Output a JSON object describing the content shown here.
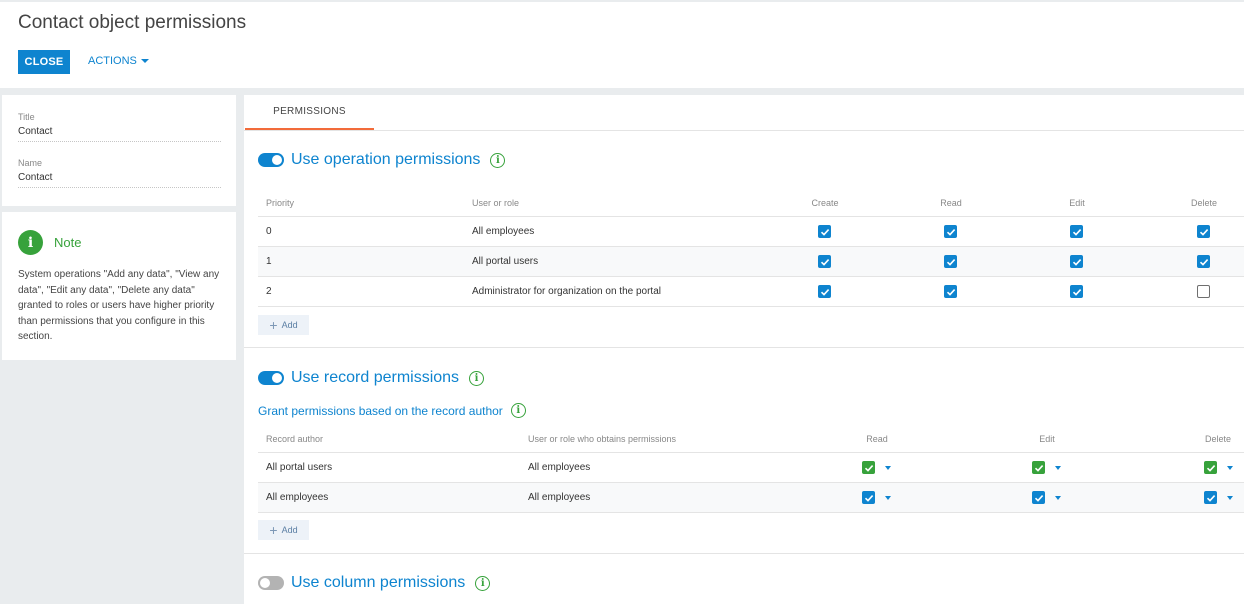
{
  "header": {
    "title": "Contact object permissions",
    "close_label": "CLOSE",
    "actions_label": "ACTIONS"
  },
  "details": {
    "title_label": "Title",
    "title_value": "Contact",
    "name_label": "Name",
    "name_value": "Contact"
  },
  "note": {
    "title": "Note",
    "text": "System operations \"Add any data\", \"View any data\", \"Edit any data\", \"Delete any data\" granted to roles or users have higher priority than permissions that you configure in this section."
  },
  "tabs": [
    {
      "label": "PERMISSIONS",
      "active": true
    }
  ],
  "operation_permissions": {
    "title": "Use operation permissions",
    "enabled": true,
    "columns": [
      "Priority",
      "User or role",
      "Create",
      "Read",
      "Edit",
      "Delete"
    ],
    "rows": [
      {
        "priority": "0",
        "role": "All employees",
        "create": true,
        "read": true,
        "edit": true,
        "delete": true
      },
      {
        "priority": "1",
        "role": "All portal users",
        "create": true,
        "read": true,
        "edit": true,
        "delete": true
      },
      {
        "priority": "2",
        "role": "Administrator for organization on the portal",
        "create": true,
        "read": true,
        "edit": true,
        "delete": false
      }
    ],
    "add_label": "Add"
  },
  "record_permissions": {
    "title": "Use record permissions",
    "enabled": true,
    "subtitle": "Grant permissions based on the record author",
    "columns": [
      "Record author",
      "User or role who obtains permissions",
      "Read",
      "Edit",
      "Delete"
    ],
    "rows": [
      {
        "author": "All portal users",
        "grantee": "All employees",
        "read": "green",
        "edit": "green",
        "delete": "green"
      },
      {
        "author": "All employees",
        "grantee": "All employees",
        "read": "blue",
        "edit": "blue",
        "delete": "blue"
      }
    ],
    "add_label": "Add"
  },
  "column_permissions": {
    "title": "Use column permissions",
    "enabled": false
  },
  "colors": {
    "accent": "#0e84cf",
    "success": "#37a23b",
    "tab_underline": "#f26b3a"
  }
}
